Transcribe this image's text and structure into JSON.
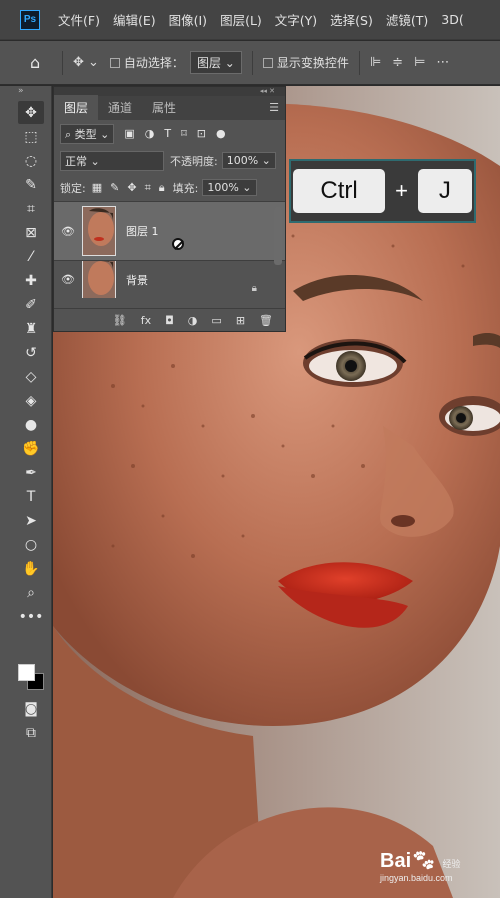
{
  "menubar": {
    "logo": "Ps",
    "items": [
      "文件(F)",
      "编辑(E)",
      "图像(I)",
      "图层(L)",
      "文字(Y)",
      "选择(S)",
      "滤镜(T)",
      "3D("
    ]
  },
  "options": {
    "auto_select_label": "自动选择：",
    "auto_select_value": "图层",
    "show_transform_label": "显示变换控件"
  },
  "layers_panel": {
    "tabs": [
      "图层",
      "通道",
      "属性"
    ],
    "filter_type": "类型",
    "blend_mode": "正常",
    "opacity_label": "不透明度:",
    "opacity_value": "100%",
    "lock_label": "锁定:",
    "fill_label": "填充:",
    "fill_value": "100%",
    "layers": [
      {
        "name": "图层 1",
        "selected": true
      },
      {
        "name": "背景",
        "selected": false
      }
    ],
    "footer_fx": "fx"
  },
  "shortcut": {
    "key1": "Ctrl",
    "plus": "+",
    "key2": "J"
  },
  "watermark": {
    "brand": "Bai",
    "brand2": "经验",
    "url": "jingyan.baidu.com"
  }
}
